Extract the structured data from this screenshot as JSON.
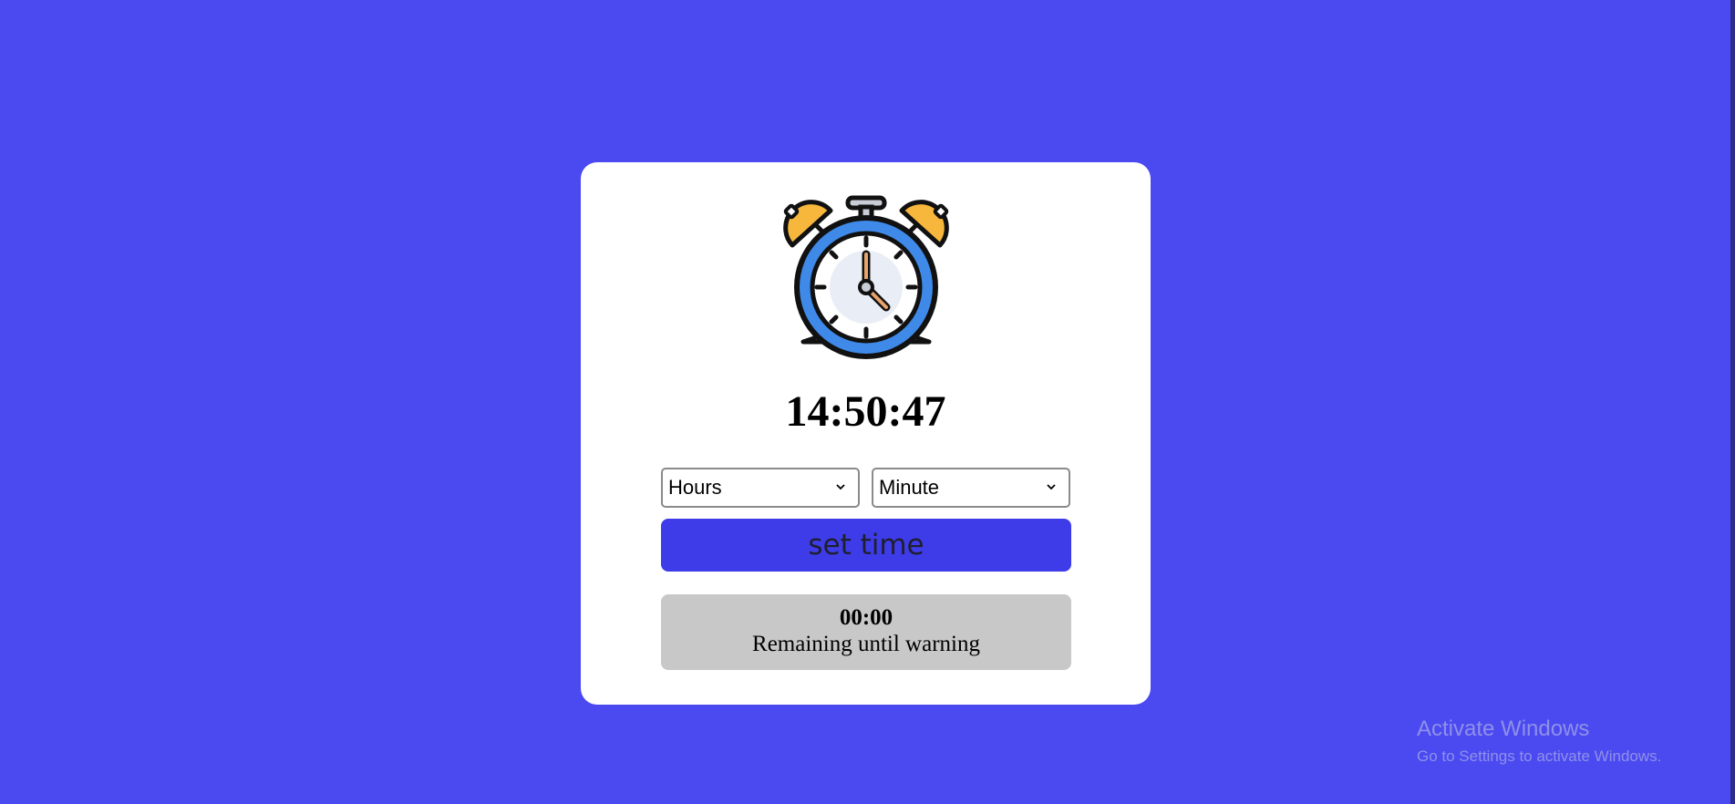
{
  "colors": {
    "page_background": "#4a4af0",
    "card_background": "#ffffff",
    "button_background": "#3d3ce8",
    "countdown_background": "#c8c8c8"
  },
  "clock": {
    "icon": "alarm-clock-icon",
    "time": "14:50:47"
  },
  "controls": {
    "hours_select": {
      "value": "Hours"
    },
    "minute_select": {
      "value": "Minute"
    },
    "set_button_label": "set time"
  },
  "countdown": {
    "value": "00:00",
    "label": "Remaining until warning"
  },
  "watermark": {
    "title": "Activate Windows",
    "subtitle": "Go to Settings to activate Windows."
  }
}
